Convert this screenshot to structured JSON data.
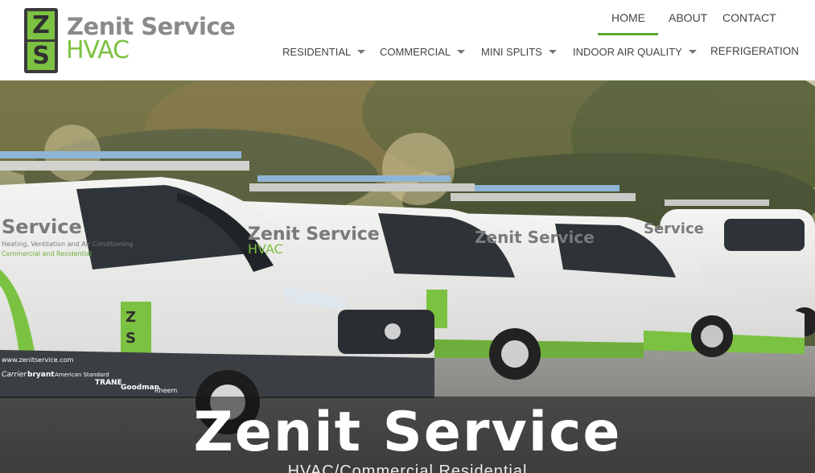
{
  "logo": {
    "badge_top": "Z",
    "badge_bottom": "S",
    "line1": "Zenit Service",
    "line2": "HVAC"
  },
  "nav": {
    "top": [
      "HOME",
      "ABOUT",
      "CONTACT"
    ],
    "active": "HOME",
    "menu": [
      {
        "label": "RESIDENTIAL",
        "dropdown": true
      },
      {
        "label": "COMMERCIAL",
        "dropdown": true
      },
      {
        "label": "MINI SPLITS",
        "dropdown": true
      },
      {
        "label": "INDOOR AIR QUALITY",
        "dropdown": true
      },
      {
        "label": "REFRIGERATION",
        "dropdown": false
      }
    ]
  },
  "hero": {
    "title": "Zenit Service",
    "subtitle": "HVAC/Commercial Residential",
    "van_lettering": {
      "brand": "Zenit Service",
      "brand_sub": "HVAC",
      "tagline": "Heating, Ventilation and Air Conditioning",
      "tagline2": "Commercial and Residential",
      "website": "www.zenitservice.com",
      "partner_logos": [
        "Carrier",
        "bryant",
        "American Standard",
        "TRANE",
        "Goodman",
        "Rheem"
      ]
    }
  },
  "colors": {
    "brand_green": "#7cc242",
    "active_underline": "#5aa832",
    "logo_gray": "#8a8a8a"
  }
}
